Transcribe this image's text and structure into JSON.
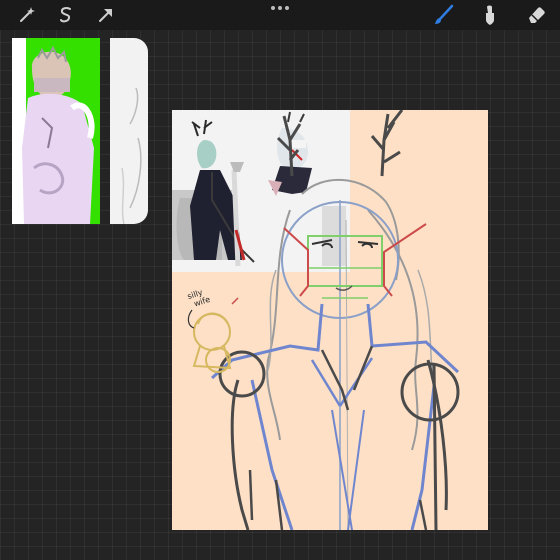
{
  "toolbar": {
    "left_tools": [
      {
        "icon": "magic-wand-icon"
      },
      {
        "icon": "selection-icon"
      },
      {
        "icon": "transform-arrow-icon"
      }
    ],
    "actions_icon": "more-dots-icon",
    "right_tools": [
      {
        "icon": "brush-icon",
        "active": true
      },
      {
        "icon": "smudge-icon"
      },
      {
        "icon": "eraser-icon"
      }
    ],
    "accent_color": "#2f7de1"
  },
  "reference": {
    "background_color": "#34e000"
  },
  "canvas": {
    "background_color": "#fde0c6",
    "sketch_colors": [
      "#4a4a4a",
      "#6f86cf",
      "#cc4a4a",
      "#7fd06a",
      "#d6b860"
    ],
    "annotation": {
      "line1": "silly",
      "line2": "wife"
    }
  }
}
